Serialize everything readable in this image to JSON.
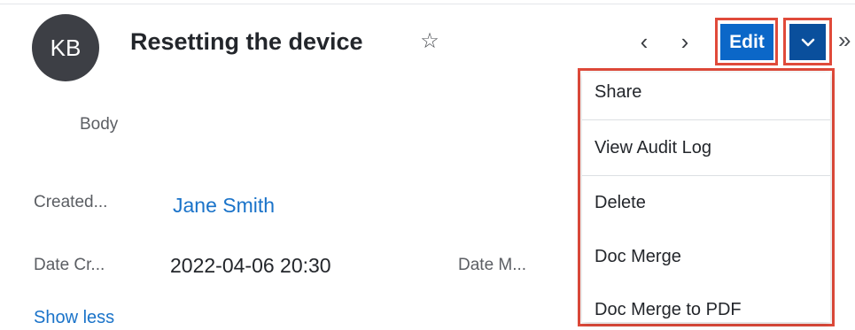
{
  "header": {
    "avatar_initials": "KB",
    "title": "Resetting the device",
    "favorite_icon": "star-outline-icon",
    "prev_icon": "chevron-left-icon",
    "next_icon": "chevron-right-icon",
    "edit_label": "Edit",
    "dropdown_icon": "chevron-down-icon",
    "more_icon": "double-chevron-right-icon"
  },
  "fields": {
    "body_label": "Body",
    "created_by_label": "Created...",
    "created_by_value": "Jane Smith",
    "date_created_label": "Date Cr...",
    "date_created_value": "2022-04-06 20:30",
    "date_modified_label": "Date M...",
    "show_less": "Show less"
  },
  "action_menu": {
    "items": [
      {
        "label": "Share"
      },
      {
        "label": "View Audit Log"
      },
      {
        "label": "Delete"
      },
      {
        "label": "Doc Merge"
      },
      {
        "label": "Doc Merge to PDF"
      }
    ]
  },
  "colors": {
    "primary_button": "#0b67c8",
    "dropdown_button": "#0a4f9c",
    "highlight": "#e04a3a",
    "link": "#1a73c9",
    "avatar_bg": "#3d3f45"
  }
}
